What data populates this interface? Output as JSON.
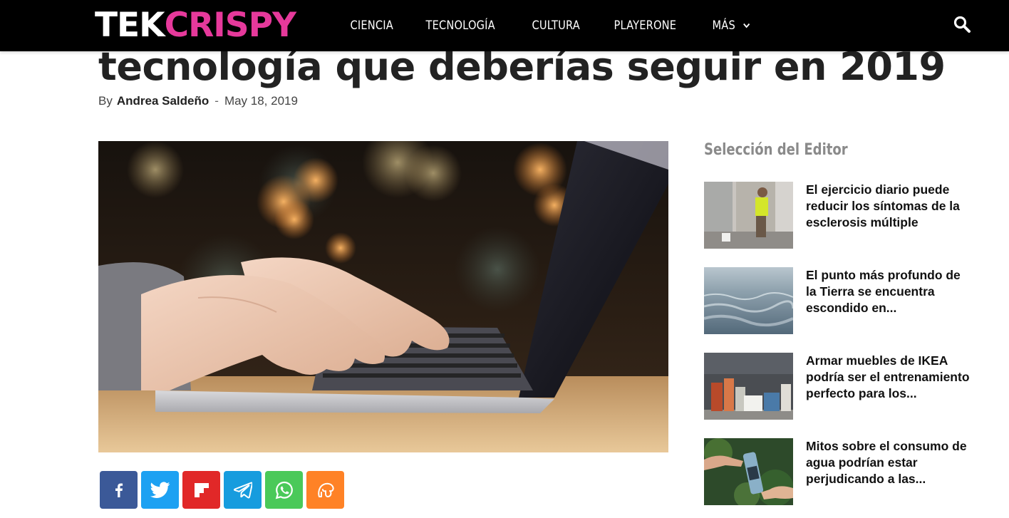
{
  "site": {
    "logo_part1": "TEK",
    "logo_part2": "CRISPY",
    "brand_color": "#e6399b"
  },
  "nav": {
    "items": [
      {
        "label": "CIENCIA"
      },
      {
        "label": "TECNOLOGÍA"
      },
      {
        "label": "CULTURA"
      },
      {
        "label": "PLAYERONE"
      },
      {
        "label": "MÁS"
      }
    ],
    "more_icon": "chevron-down-icon",
    "search_icon": "search-icon"
  },
  "article": {
    "title_visible": "tecnología que deberías seguir en 2019",
    "by_label": "By",
    "author": "Andrea Saldeño",
    "separator": "-",
    "date": "May 18, 2019",
    "hero_image": "hands typing on laptop with bokeh lights background"
  },
  "share": [
    {
      "network": "facebook",
      "icon": "facebook-icon",
      "color": "#3b5998"
    },
    {
      "network": "twitter",
      "icon": "twitter-icon",
      "color": "#1da1f2"
    },
    {
      "network": "flipboard",
      "icon": "flipboard-icon",
      "color": "#e12828"
    },
    {
      "network": "telegram",
      "icon": "telegram-icon",
      "color": "#179cde"
    },
    {
      "network": "whatsapp",
      "icon": "whatsapp-icon",
      "color": "#4ac959"
    },
    {
      "network": "mix",
      "icon": "mix-icon",
      "color": "#ff8226"
    }
  ],
  "sidebar": {
    "title": "Selección del Editor",
    "items": [
      {
        "title": "El ejercicio diario puede reducir los síntomas de la esclerosis múltiple"
      },
      {
        "title": "El punto más profundo de la Tierra se encuentra escondido en..."
      },
      {
        "title": "Armar muebles de IKEA podría ser el entrenamiento perfecto para los..."
      },
      {
        "title": "Mitos sobre el consumo de agua podrían estar perjudicando a las..."
      }
    ]
  }
}
